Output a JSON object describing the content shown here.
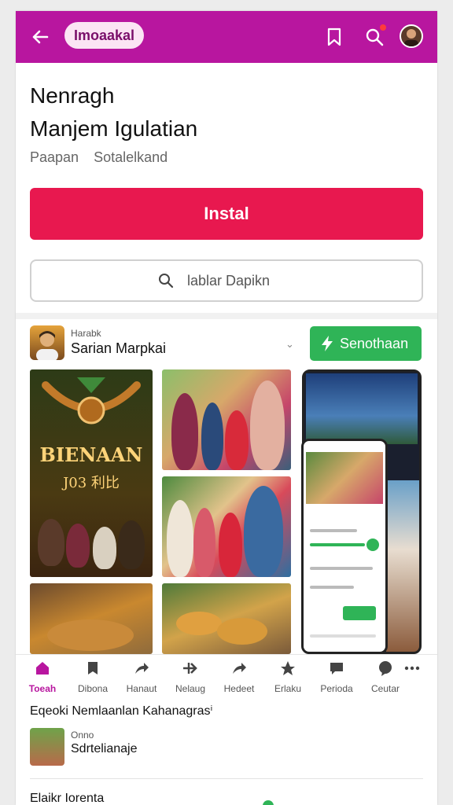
{
  "topbar": {
    "pill_label": "Imoaakal",
    "accent": "#b8169f"
  },
  "header": {
    "title_line1": "Nenragh",
    "title_line2": "Manjem Igulatian",
    "sub_left": "Paapan",
    "sub_right": "Sotalelkand"
  },
  "install": {
    "label": "Instal",
    "color": "#e8184f"
  },
  "search": {
    "placeholder": "lablar Dapikn"
  },
  "app": {
    "small_label": "Harabk",
    "name": "Sarian Marpkai",
    "action_label": "Senothaan",
    "action_color": "#2fb457"
  },
  "gallery": {
    "poster_line1": "BIENAAN",
    "poster_line2": "J03 利比"
  },
  "tabs": [
    {
      "label": "Toeah",
      "icon": "home-icon"
    },
    {
      "label": "Dibona",
      "icon": "bookmark-icon"
    },
    {
      "label": "Hanaut",
      "icon": "share-icon"
    },
    {
      "label": "Nelaug",
      "icon": "arrow-icon"
    },
    {
      "label": "Hedeet",
      "icon": "forward-icon"
    },
    {
      "label": "Erlaku",
      "icon": "star-icon"
    },
    {
      "label": "Perioda",
      "icon": "chat-icon"
    },
    {
      "label": "Ceutar",
      "icon": "bubble-icon"
    }
  ],
  "section": {
    "title": "Eqeoki Nemlaanlan Kahanagrasⁱ"
  },
  "row": {
    "small_label": "Onno",
    "name": "Sdrtelianaje"
  },
  "bottom": {
    "title": "Elaikr Iorenta"
  }
}
